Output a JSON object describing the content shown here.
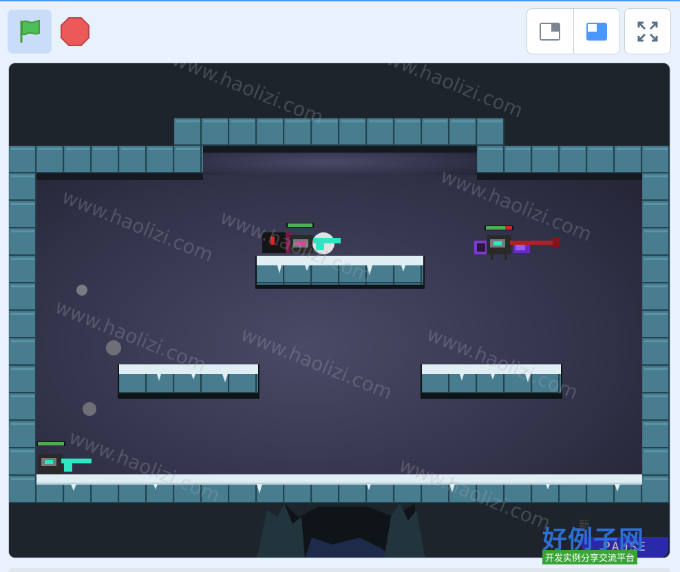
{
  "toolbar": {
    "green_flag_icon": "green-flag-icon",
    "stop_icon": "stop-icon",
    "small_stage_icon": "small-stage-icon",
    "large_stage_icon": "large-stage-icon",
    "fullscreen_icon": "fullscreen-icon",
    "colors": {
      "accent": "#4c97ff",
      "flag": "#4cbf56",
      "stop": "#ec5959"
    }
  },
  "stage": {
    "pause_label": "PAUSE",
    "colors": {
      "sky_top": "#1d242c",
      "cave_bg": "#3a3a52",
      "brick": "#3f7384",
      "snow": "#dfeef3",
      "health_green": "#4caf50",
      "health_red": "#d8232a",
      "gun_cyan": "#2ee6c2"
    }
  },
  "watermark": {
    "text": "www.haolizi.com",
    "brand": "好例子网",
    "brand_sup": "新",
    "brand_sub": "开发实例分享交流平台"
  }
}
